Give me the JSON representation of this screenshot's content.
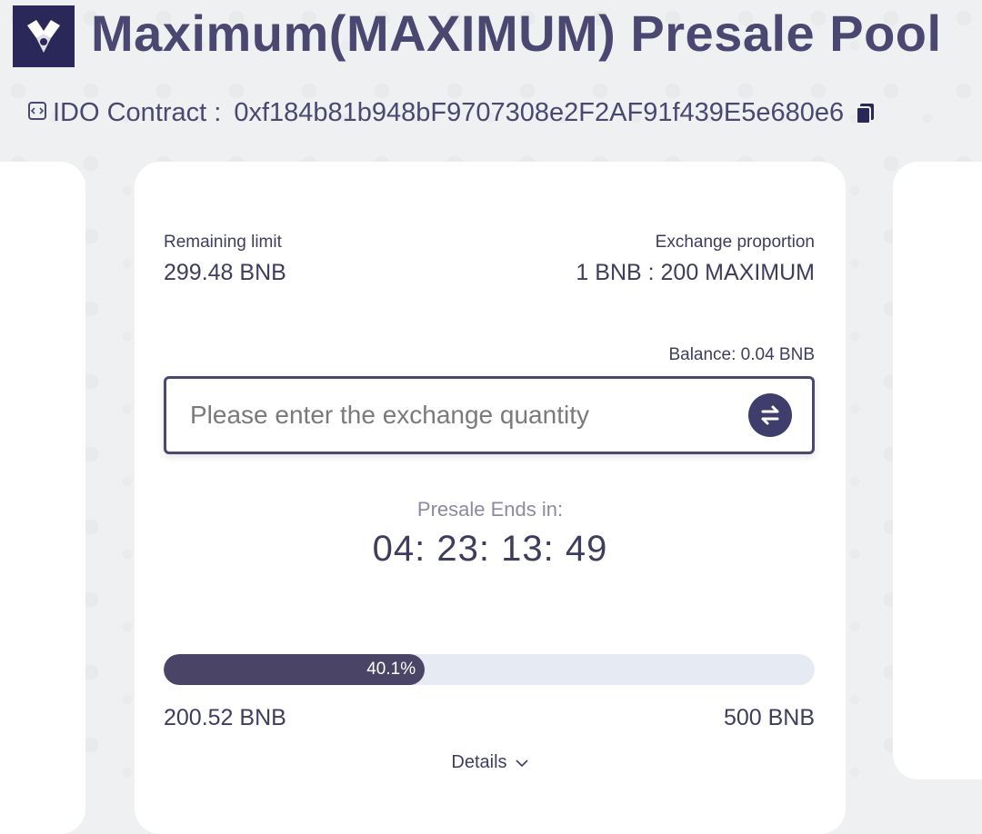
{
  "header": {
    "title": "Maximum(MAXIMUM) Presale Pool",
    "contract_label": "IDO Contract :",
    "contract_address": "0xf184b81b948bF9707308e2F2AF91f439E5e680e6"
  },
  "pool": {
    "remaining_label": "Remaining limit",
    "remaining_value": "299.48 BNB",
    "proportion_label": "Exchange proportion",
    "proportion_value": "1 BNB : 200 MAXIMUM",
    "balance": "Balance: 0.04 BNB",
    "input_placeholder": "Please enter the exchange quantity",
    "ends_label": "Presale Ends in:",
    "countdown": "04: 23: 13: 49",
    "progress_percent": 40.1,
    "progress_label": "40.1%",
    "raised": "200.52 BNB",
    "cap": "500 BNB",
    "details_label": "Details"
  },
  "icons": {
    "logo": "maximum-logo",
    "contract": "contract-code-icon",
    "copy": "copy-icon",
    "swap": "swap-arrows-icon",
    "chevron": "chevron-down-icon"
  },
  "colors": {
    "brand": "#2a2858",
    "text": "#3f3d5e",
    "progress_fill": "#4a4466",
    "progress_track": "#e6ebf3"
  }
}
